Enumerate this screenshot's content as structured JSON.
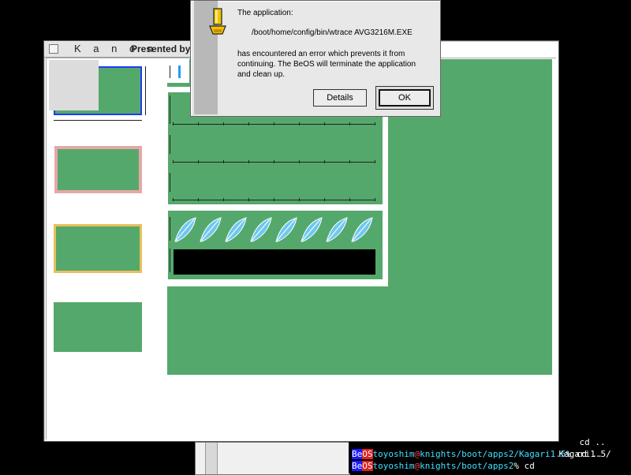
{
  "main_window": {
    "title": "K a n o n",
    "subtitle": "Presented by"
  },
  "dialog": {
    "line1": "The application:",
    "path": "/boot/home/config/bin/wtrace AVG3216M.EXE",
    "message_line1": "has encountered an error which prevents it from",
    "message_line2": "continuing. The BeOS will terminate the application",
    "message_line3": "and clean up.",
    "details_label": "Details",
    "ok_label": "OK",
    "icon": "warning-icon"
  },
  "terminal": {
    "line0_cmd": "cd ..",
    "line1_tail": "Kagari1.5/",
    "line2_tag_be": "Be",
    "line2_tag_os": "OS",
    "line2_user": "toyoshim",
    "line2_at": "@",
    "line2_host": "knights/boot/apps2/Kagari1.5",
    "line2_prompt": "%",
    "line2_cmd": "cd ..",
    "line3_tag_be": "Be",
    "line3_tag_os": "OS",
    "line3_user": "toyoshim",
    "line3_at": "@",
    "line3_host": "knights/boot/apps2",
    "line3_prompt": "%",
    "line3_cmd": "cd"
  },
  "colors": {
    "green": "#55a86b",
    "blue_frame": "#1e3cff",
    "pink_frame": "#e7a7a7",
    "gold_frame": "#e8c05a",
    "feather": "#6ec8f0"
  }
}
